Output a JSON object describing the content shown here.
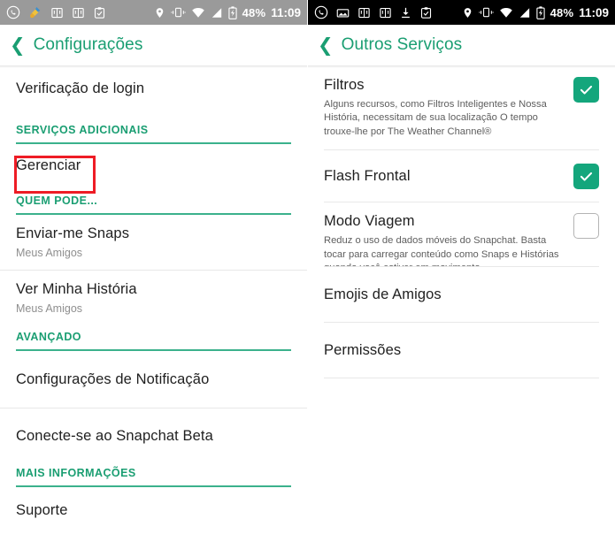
{
  "status_bar": {
    "left_screen": {
      "background": "#9a9a9a",
      "notification_icons": [
        "whatsapp-icon",
        "cleaner-broom-icon",
        "book-icon",
        "book-icon",
        "clipboard-check-icon"
      ],
      "system_icons": [
        "location-pin-icon",
        "vibrate-icon",
        "wifi-icon",
        "signal-icon",
        "battery-charging-icon"
      ],
      "battery": "48%",
      "time": "11:09"
    },
    "right_screen": {
      "background": "#000000",
      "notification_icons": [
        "whatsapp-icon",
        "image-icon",
        "book-icon",
        "book-icon",
        "download-icon",
        "clipboard-check-icon"
      ],
      "system_icons": [
        "location-pin-icon",
        "vibrate-icon",
        "wifi-icon",
        "signal-icon",
        "battery-charging-icon"
      ],
      "battery": "48%",
      "time": "11:09"
    }
  },
  "accent_color": "#1a9e72",
  "highlight_color": "#ee1c25",
  "left_screen": {
    "appbar": {
      "back_icon": "chevron-left-icon",
      "title": "Configurações"
    },
    "items": [
      {
        "type": "row",
        "label": "Verificação de login"
      },
      {
        "type": "section",
        "label": "SERVIÇOS ADICIONAIS"
      },
      {
        "type": "row",
        "label": "Gerenciar",
        "highlighted": true
      },
      {
        "type": "section",
        "label": "QUEM PODE..."
      },
      {
        "type": "row",
        "label": "Enviar-me Snaps",
        "sub": "Meus Amigos"
      },
      {
        "type": "row",
        "label": "Ver Minha História",
        "sub": "Meus Amigos"
      },
      {
        "type": "section",
        "label": "AVANÇADO"
      },
      {
        "type": "row",
        "label": "Configurações de Notificação"
      },
      {
        "type": "row",
        "label": "Conecte-se ao Snapchat Beta"
      },
      {
        "type": "section",
        "label": "MAIS INFORMAÇÕES"
      },
      {
        "type": "row",
        "label": "Suporte"
      }
    ]
  },
  "right_screen": {
    "appbar": {
      "back_icon": "chevron-left-icon",
      "title": "Outros Serviços"
    },
    "items": [
      {
        "type": "toggle",
        "label": "Filtros",
        "desc": "Alguns recursos, como Filtros Inteligentes e Nossa História, necessitam de sua localização O tempo trouxe-lhe por The Weather Channel®",
        "checked": true
      },
      {
        "type": "toggle",
        "label": "Flash Frontal",
        "desc": "",
        "checked": true
      },
      {
        "type": "toggle",
        "label": "Modo Viagem",
        "desc": "Reduz o uso de dados móveis do Snapchat. Basta tocar para carregar conteúdo como Snaps e Histórias quando você estiver em movimento",
        "checked": false
      },
      {
        "type": "row",
        "label": "Emojis de Amigos"
      },
      {
        "type": "row",
        "label": "Permissões"
      }
    ]
  }
}
